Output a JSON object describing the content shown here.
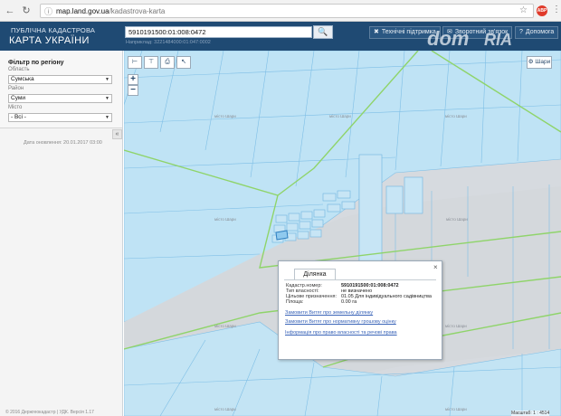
{
  "browser": {
    "url_host": "map.land.gov.ua",
    "url_path": "/kadastrova-karta",
    "adblock_badge": "ABP"
  },
  "header": {
    "logo_line1": "ПУБЛІЧНА КАДАСТРОВА",
    "logo_line2": "КАРТА УКРАЇНИ",
    "search_value": "5910191500:01:008:0472",
    "search_hint": "Наприклад: 3221484000:01:047:0002",
    "tools_label": "Технічні підтримка",
    "feedback_label": "Зворотний зв'язок",
    "help_label": "Допомога",
    "watermark_left": "dom",
    "watermark_right": "RIA"
  },
  "sidebar": {
    "filter_title": "Фільтр по регіону",
    "oblast_label": "Область",
    "oblast_value": "Сумська",
    "rayon_label": "Район",
    "rayon_value": "Суми",
    "misto_label": "Місто",
    "misto_value": "- Всі -",
    "updated": "Дата оновлення: 20.01.2017 03:00",
    "footer": "© 2016 Держгеокадастр | УДК. Версія 1.17"
  },
  "map": {
    "layers_label": "Шари",
    "scale_text": "Масштаб: 1 : 4514",
    "place_labels": [
      "місто Шари",
      "місто Шари",
      "місто Шари",
      "місто Шари",
      "місто Шари",
      "місто Шари",
      "місто Шари",
      "місто Шари",
      "місто Шари"
    ]
  },
  "popup": {
    "tab_label": "Ділянка",
    "rows": [
      {
        "key": "Кадастр.номер:",
        "value": "5910191500:01:008:0472"
      },
      {
        "key": "Тип власності:",
        "value": "не визначено"
      },
      {
        "key": "Цільове призначення:",
        "value": "01.05 Для індивідуального садівництва"
      },
      {
        "key": "Площа:",
        "value": "0.00 га"
      }
    ],
    "links": [
      "Замовити Витяг про земельну ділянку",
      "Замовити Витяг про нормативну грошову оцінку",
      "Інформація про право власності та речові права"
    ]
  }
}
